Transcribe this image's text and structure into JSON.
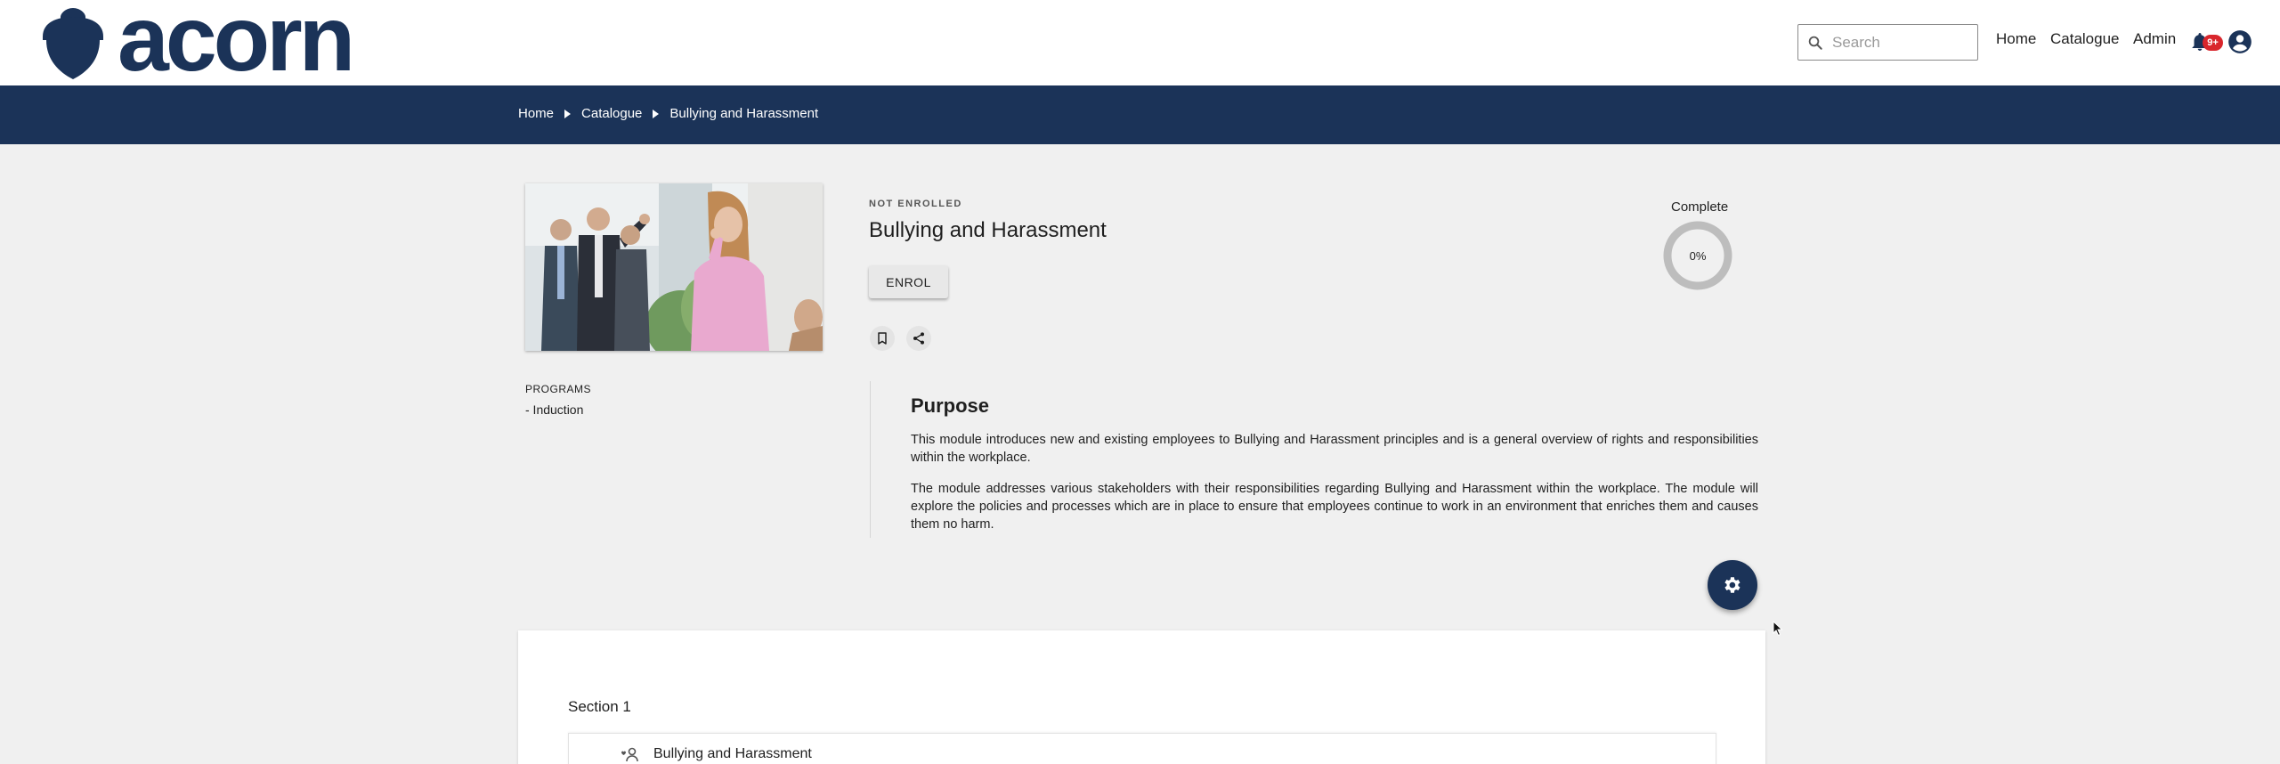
{
  "header": {
    "brand": "acorn",
    "search_placeholder": "Search",
    "nav": {
      "home": "Home",
      "catalogue": "Catalogue",
      "admin": "Admin"
    },
    "notification_badge": "9+",
    "icons": [
      "search-icon",
      "bell-icon",
      "account-icon",
      "acorn-logo-icon"
    ]
  },
  "breadcrumb": {
    "items": [
      "Home",
      "Catalogue",
      "Bullying and Harassment"
    ]
  },
  "course": {
    "status": "NOT ENROLLED",
    "title": "Bullying and Harassment",
    "enrol_label": "ENROL",
    "complete_label": "Complete",
    "progress_text": "0%",
    "progress_value": 0
  },
  "programs": {
    "label": "PROGRAMS",
    "items": [
      "- Induction"
    ]
  },
  "purpose": {
    "title": "Purpose",
    "paragraphs": [
      "This module introduces new and existing employees to Bullying and Harassment principles and is a general overview of rights and responsibilities within the workplace.",
      "The module addresses various stakeholders with their responsibilities regarding Bullying and Harassment within the workplace. The module will explore the policies and processes which are in place to ensure that employees continue to work in an environment that enriches them and causes them no harm."
    ]
  },
  "sections": [
    {
      "title": "Section 1",
      "activities": [
        {
          "title": "Bullying and Harassment"
        }
      ]
    }
  ],
  "colors": {
    "brand_navy": "#1b3358",
    "badge_red": "#d9262c",
    "page_bg": "#f0f0f0"
  }
}
